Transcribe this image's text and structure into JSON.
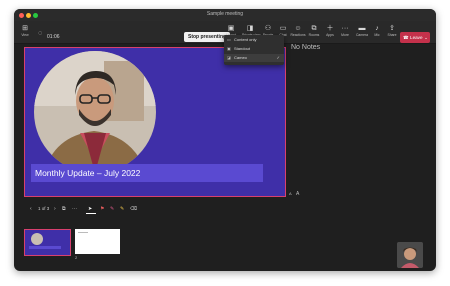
{
  "window": {
    "title": "Sample meeting"
  },
  "traffic_colors": {
    "close": "#ff5f57",
    "minimize": "#febc2e",
    "maximize": "#28c840"
  },
  "toolbar": {
    "view_label": "View",
    "timer": "01:06",
    "stop_label": "Stop presenting",
    "items": [
      {
        "label": "Layout",
        "icon": "layout-icon"
      },
      {
        "label": "Private view",
        "icon": "private-view-icon"
      },
      {
        "label": "People",
        "icon": "people-icon"
      },
      {
        "label": "Chat",
        "icon": "chat-icon"
      },
      {
        "label": "Reactions",
        "icon": "reactions-icon"
      },
      {
        "label": "Rooms",
        "icon": "rooms-icon"
      },
      {
        "label": "Apps",
        "icon": "apps-icon"
      },
      {
        "label": "More",
        "icon": "more-icon"
      },
      {
        "label": "Camera",
        "icon": "camera-icon"
      },
      {
        "label": "Mic",
        "icon": "mic-icon"
      },
      {
        "label": "Share",
        "icon": "share-icon"
      }
    ],
    "leave_label": "Leave"
  },
  "layout_menu": {
    "items": [
      {
        "label": "Content only"
      },
      {
        "label": "Standout"
      },
      {
        "label": "Cameo",
        "selected": true
      }
    ]
  },
  "slide": {
    "caption": "Monthly Update – July 2022"
  },
  "notes": {
    "text": "No Notes"
  },
  "controls": {
    "page": "1 of 3"
  },
  "zoom": {
    "out": "A",
    "in": "A"
  },
  "thumbnail": {
    "number": "2"
  },
  "colors": {
    "slide_bg": "#3f2fa8",
    "accent": "#d8406e",
    "leave": "#c4314b"
  }
}
